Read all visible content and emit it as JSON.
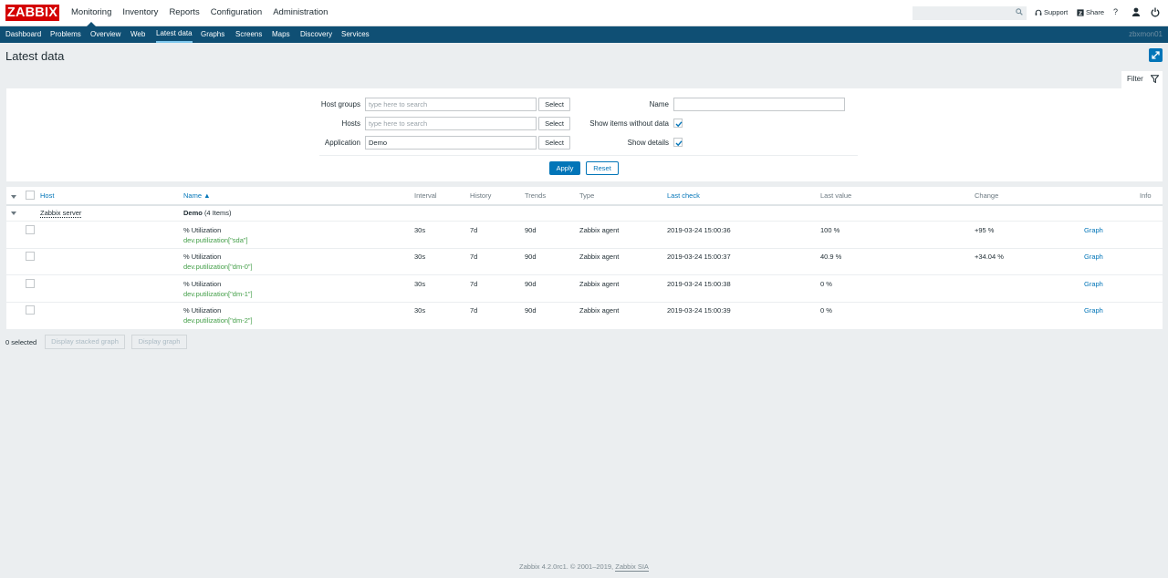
{
  "header": {
    "logo": "ZABBIX",
    "menu": [
      {
        "label": "Monitoring",
        "selected": true
      },
      {
        "label": "Inventory"
      },
      {
        "label": "Reports"
      },
      {
        "label": "Configuration"
      },
      {
        "label": "Administration"
      }
    ],
    "search_placeholder": "",
    "support_label": "Support",
    "share_label": "Share",
    "help_label": "?"
  },
  "subnav": {
    "items": [
      "Dashboard",
      "Problems",
      "Overview",
      "Web",
      "Latest data",
      "Graphs",
      "Screens",
      "Maps",
      "Discovery",
      "Services"
    ],
    "selected": "Latest data",
    "hostname": "zbxmon01"
  },
  "page": {
    "title": "Latest data"
  },
  "filter": {
    "tab_label": "Filter",
    "host_groups_label": "Host groups",
    "host_groups_placeholder": "type here to search",
    "hosts_label": "Hosts",
    "hosts_placeholder": "type here to search",
    "application_label": "Application",
    "application_value": "Demo",
    "select_label": "Select",
    "name_label": "Name",
    "name_value": "",
    "show_items_without_data_label": "Show items without data",
    "show_items_without_data": true,
    "show_details_label": "Show details",
    "show_details": true,
    "apply_label": "Apply",
    "reset_label": "Reset"
  },
  "table": {
    "columns": {
      "host": "Host",
      "name": "Name ▲",
      "interval": "Interval",
      "history": "History",
      "trends": "Trends",
      "type": "Type",
      "last_check": "Last check",
      "last_value": "Last value",
      "change": "Change",
      "info": "Info"
    },
    "group": {
      "host": "Zabbix server",
      "application": "Demo",
      "count": "(4 Items)"
    },
    "rows": [
      {
        "name": "% Utilization",
        "key": "dev.putilization[\"sda\"]",
        "interval": "30s",
        "history": "7d",
        "trends": "90d",
        "type": "Zabbix agent",
        "last_check": "2019-03-24 15:00:36",
        "last_value": "100 %",
        "change": "+95 %",
        "graph": "Graph"
      },
      {
        "name": "% Utilization",
        "key": "dev.putilization[\"dm-0\"]",
        "interval": "30s",
        "history": "7d",
        "trends": "90d",
        "type": "Zabbix agent",
        "last_check": "2019-03-24 15:00:37",
        "last_value": "40.9 %",
        "change": "+34.04 %",
        "graph": "Graph"
      },
      {
        "name": "% Utilization",
        "key": "dev.putilization[\"dm-1\"]",
        "interval": "30s",
        "history": "7d",
        "trends": "90d",
        "type": "Zabbix agent",
        "last_check": "2019-03-24 15:00:38",
        "last_value": "0 %",
        "change": "",
        "graph": "Graph"
      },
      {
        "name": "% Utilization",
        "key": "dev.putilization[\"dm-2\"]",
        "interval": "30s",
        "history": "7d",
        "trends": "90d",
        "type": "Zabbix agent",
        "last_check": "2019-03-24 15:00:39",
        "last_value": "0 %",
        "change": "",
        "graph": "Graph"
      }
    ]
  },
  "actions": {
    "selected_count": "0 selected",
    "stacked_graph": "Display stacked graph",
    "graph": "Display graph"
  },
  "footer": {
    "text": "Zabbix 4.2.0rc1. © 2001–2019,",
    "company": "Zabbix SIA"
  }
}
